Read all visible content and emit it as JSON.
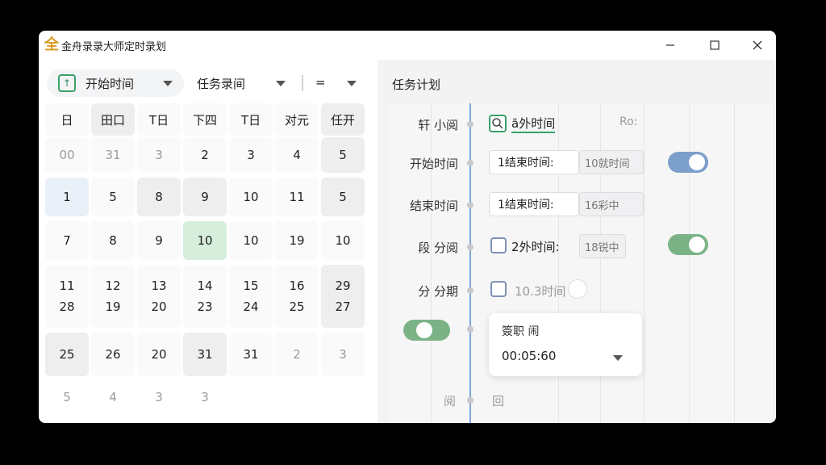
{
  "window": {
    "title": "金舟录录大师定时录划",
    "app_icon": "app-logo",
    "controls": [
      "minimize-icon",
      "maximize-icon",
      "close-icon"
    ]
  },
  "toolbar": {
    "start_label": "开始时间",
    "task_label": "任务录间",
    "eq_label": "="
  },
  "calendar": {
    "headers": [
      "日",
      "田口",
      "T日",
      "下四",
      "T日",
      "对元",
      "任开"
    ],
    "rows": [
      [
        "00",
        "31",
        "3",
        "2",
        "3",
        "4",
        "5"
      ],
      [
        "1",
        "5",
        "8",
        "9",
        "10",
        "11",
        "5"
      ],
      [
        "7",
        "8",
        "9",
        "10",
        "10",
        "19",
        "10"
      ],
      [
        "11\n28",
        "12\n19",
        "13\n20",
        "14\n23",
        "15\n24",
        "16\n25",
        "29\n27"
      ],
      [
        "25",
        "26",
        "20",
        "31",
        "31",
        "2",
        "3"
      ],
      [
        "5",
        "4",
        "3",
        "3",
        "",
        "",
        ""
      ]
    ]
  },
  "plan": {
    "title": "任务计划",
    "rows": [
      {
        "label": "轩   小阅",
        "value": "ă外时间",
        "extra": "Ro:"
      },
      {
        "label": "开始时间",
        "value": "1结束时间:",
        "extra": "10就时间"
      },
      {
        "label": "结束时间",
        "value": "1结束时间:",
        "extra": "16彩中"
      },
      {
        "label": "段    分阅",
        "value": "2外时间:",
        "extra": "18锐中"
      },
      {
        "label": "分    分期",
        "value": "10.3时间"
      }
    ],
    "card": {
      "title": "簽职 闹",
      "value": "00:05:60"
    },
    "bottom_left": "阅",
    "bottom_right": "回"
  },
  "colors": {
    "accent_green": "#7bb387",
    "accent_blue": "#7c9fcb",
    "highlight_green": "#d6eedb",
    "timeline": "#7aa6d6"
  }
}
